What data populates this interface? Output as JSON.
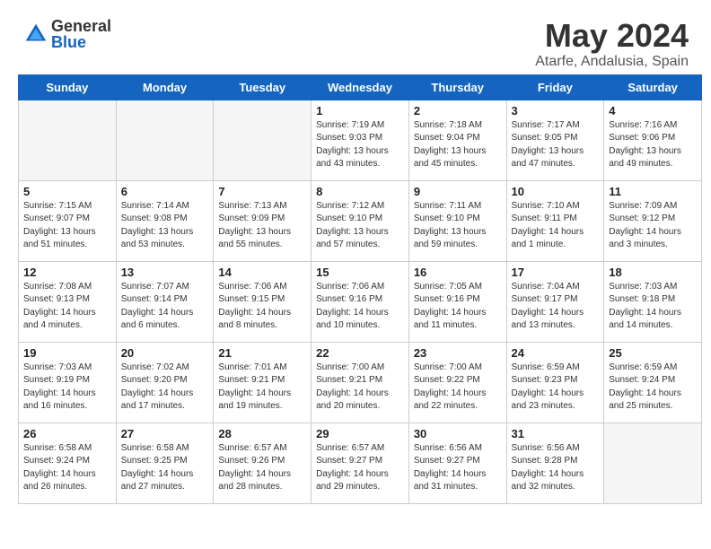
{
  "header": {
    "logo_general": "General",
    "logo_blue": "Blue",
    "month": "May 2024",
    "location": "Atarfe, Andalusia, Spain"
  },
  "columns": [
    "Sunday",
    "Monday",
    "Tuesday",
    "Wednesday",
    "Thursday",
    "Friday",
    "Saturday"
  ],
  "weeks": [
    [
      {
        "day": "",
        "info": ""
      },
      {
        "day": "",
        "info": ""
      },
      {
        "day": "",
        "info": ""
      },
      {
        "day": "1",
        "info": "Sunrise: 7:19 AM\nSunset: 9:03 PM\nDaylight: 13 hours\nand 43 minutes."
      },
      {
        "day": "2",
        "info": "Sunrise: 7:18 AM\nSunset: 9:04 PM\nDaylight: 13 hours\nand 45 minutes."
      },
      {
        "day": "3",
        "info": "Sunrise: 7:17 AM\nSunset: 9:05 PM\nDaylight: 13 hours\nand 47 minutes."
      },
      {
        "day": "4",
        "info": "Sunrise: 7:16 AM\nSunset: 9:06 PM\nDaylight: 13 hours\nand 49 minutes."
      }
    ],
    [
      {
        "day": "5",
        "info": "Sunrise: 7:15 AM\nSunset: 9:07 PM\nDaylight: 13 hours\nand 51 minutes."
      },
      {
        "day": "6",
        "info": "Sunrise: 7:14 AM\nSunset: 9:08 PM\nDaylight: 13 hours\nand 53 minutes."
      },
      {
        "day": "7",
        "info": "Sunrise: 7:13 AM\nSunset: 9:09 PM\nDaylight: 13 hours\nand 55 minutes."
      },
      {
        "day": "8",
        "info": "Sunrise: 7:12 AM\nSunset: 9:10 PM\nDaylight: 13 hours\nand 57 minutes."
      },
      {
        "day": "9",
        "info": "Sunrise: 7:11 AM\nSunset: 9:10 PM\nDaylight: 13 hours\nand 59 minutes."
      },
      {
        "day": "10",
        "info": "Sunrise: 7:10 AM\nSunset: 9:11 PM\nDaylight: 14 hours\nand 1 minute."
      },
      {
        "day": "11",
        "info": "Sunrise: 7:09 AM\nSunset: 9:12 PM\nDaylight: 14 hours\nand 3 minutes."
      }
    ],
    [
      {
        "day": "12",
        "info": "Sunrise: 7:08 AM\nSunset: 9:13 PM\nDaylight: 14 hours\nand 4 minutes."
      },
      {
        "day": "13",
        "info": "Sunrise: 7:07 AM\nSunset: 9:14 PM\nDaylight: 14 hours\nand 6 minutes."
      },
      {
        "day": "14",
        "info": "Sunrise: 7:06 AM\nSunset: 9:15 PM\nDaylight: 14 hours\nand 8 minutes."
      },
      {
        "day": "15",
        "info": "Sunrise: 7:06 AM\nSunset: 9:16 PM\nDaylight: 14 hours\nand 10 minutes."
      },
      {
        "day": "16",
        "info": "Sunrise: 7:05 AM\nSunset: 9:16 PM\nDaylight: 14 hours\nand 11 minutes."
      },
      {
        "day": "17",
        "info": "Sunrise: 7:04 AM\nSunset: 9:17 PM\nDaylight: 14 hours\nand 13 minutes."
      },
      {
        "day": "18",
        "info": "Sunrise: 7:03 AM\nSunset: 9:18 PM\nDaylight: 14 hours\nand 14 minutes."
      }
    ],
    [
      {
        "day": "19",
        "info": "Sunrise: 7:03 AM\nSunset: 9:19 PM\nDaylight: 14 hours\nand 16 minutes."
      },
      {
        "day": "20",
        "info": "Sunrise: 7:02 AM\nSunset: 9:20 PM\nDaylight: 14 hours\nand 17 minutes."
      },
      {
        "day": "21",
        "info": "Sunrise: 7:01 AM\nSunset: 9:21 PM\nDaylight: 14 hours\nand 19 minutes."
      },
      {
        "day": "22",
        "info": "Sunrise: 7:00 AM\nSunset: 9:21 PM\nDaylight: 14 hours\nand 20 minutes."
      },
      {
        "day": "23",
        "info": "Sunrise: 7:00 AM\nSunset: 9:22 PM\nDaylight: 14 hours\nand 22 minutes."
      },
      {
        "day": "24",
        "info": "Sunrise: 6:59 AM\nSunset: 9:23 PM\nDaylight: 14 hours\nand 23 minutes."
      },
      {
        "day": "25",
        "info": "Sunrise: 6:59 AM\nSunset: 9:24 PM\nDaylight: 14 hours\nand 25 minutes."
      }
    ],
    [
      {
        "day": "26",
        "info": "Sunrise: 6:58 AM\nSunset: 9:24 PM\nDaylight: 14 hours\nand 26 minutes."
      },
      {
        "day": "27",
        "info": "Sunrise: 6:58 AM\nSunset: 9:25 PM\nDaylight: 14 hours\nand 27 minutes."
      },
      {
        "day": "28",
        "info": "Sunrise: 6:57 AM\nSunset: 9:26 PM\nDaylight: 14 hours\nand 28 minutes."
      },
      {
        "day": "29",
        "info": "Sunrise: 6:57 AM\nSunset: 9:27 PM\nDaylight: 14 hours\nand 29 minutes."
      },
      {
        "day": "30",
        "info": "Sunrise: 6:56 AM\nSunset: 9:27 PM\nDaylight: 14 hours\nand 31 minutes."
      },
      {
        "day": "31",
        "info": "Sunrise: 6:56 AM\nSunset: 9:28 PM\nDaylight: 14 hours\nand 32 minutes."
      },
      {
        "day": "",
        "info": ""
      }
    ]
  ]
}
